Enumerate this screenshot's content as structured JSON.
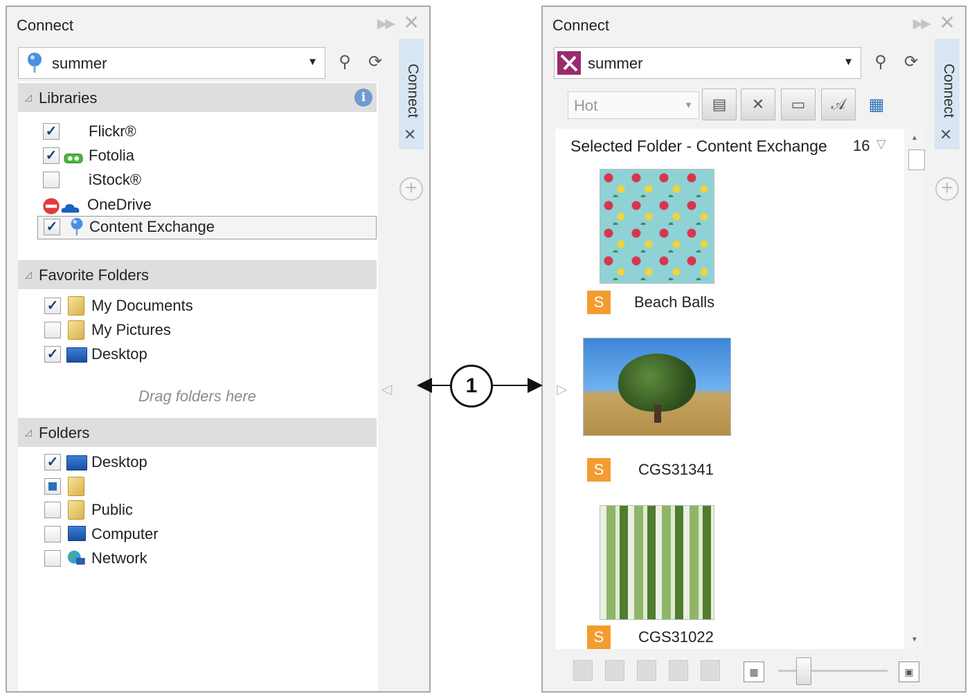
{
  "left_panel": {
    "title": "Connect",
    "search_value": "summer",
    "side_tab_label": "Connect",
    "libraries": {
      "title": "Libraries",
      "items": [
        {
          "label": "Flickr®",
          "checked": true
        },
        {
          "label": "Fotolia",
          "checked": true
        },
        {
          "label": "iStock®",
          "checked": false
        },
        {
          "label": "OneDrive",
          "checked": false
        },
        {
          "label": "Content Exchange",
          "checked": true
        }
      ]
    },
    "favorites": {
      "title": "Favorite Folders",
      "items": [
        {
          "label": "My Documents",
          "checked": true
        },
        {
          "label": "My Pictures",
          "checked": false
        },
        {
          "label": "Desktop",
          "checked": true
        }
      ],
      "drag_hint": "Drag folders here"
    },
    "folders": {
      "title": "Folders",
      "items": [
        {
          "label": "Desktop",
          "checked": true
        },
        {
          "label": "",
          "checked": "partial"
        },
        {
          "label": "Public",
          "checked": false
        },
        {
          "label": "Computer",
          "checked": false
        },
        {
          "label": "Network",
          "checked": false
        }
      ]
    }
  },
  "right_panel": {
    "title": "Connect",
    "search_value": "summer",
    "side_tab_label": "Connect",
    "sort_value": "Hot",
    "results_header": "Selected Folder - Content Exchange",
    "results_count": "16",
    "results": [
      {
        "label": "Beach Balls",
        "badge": "S"
      },
      {
        "label": "CGS31341",
        "badge": "S"
      },
      {
        "label": "CGS31022",
        "badge": "S"
      }
    ]
  },
  "callout": {
    "number": "1"
  },
  "colors": {
    "accent": "#6e9bd1",
    "badge": "#f39c31",
    "side_tab": "#d8e5f3"
  }
}
